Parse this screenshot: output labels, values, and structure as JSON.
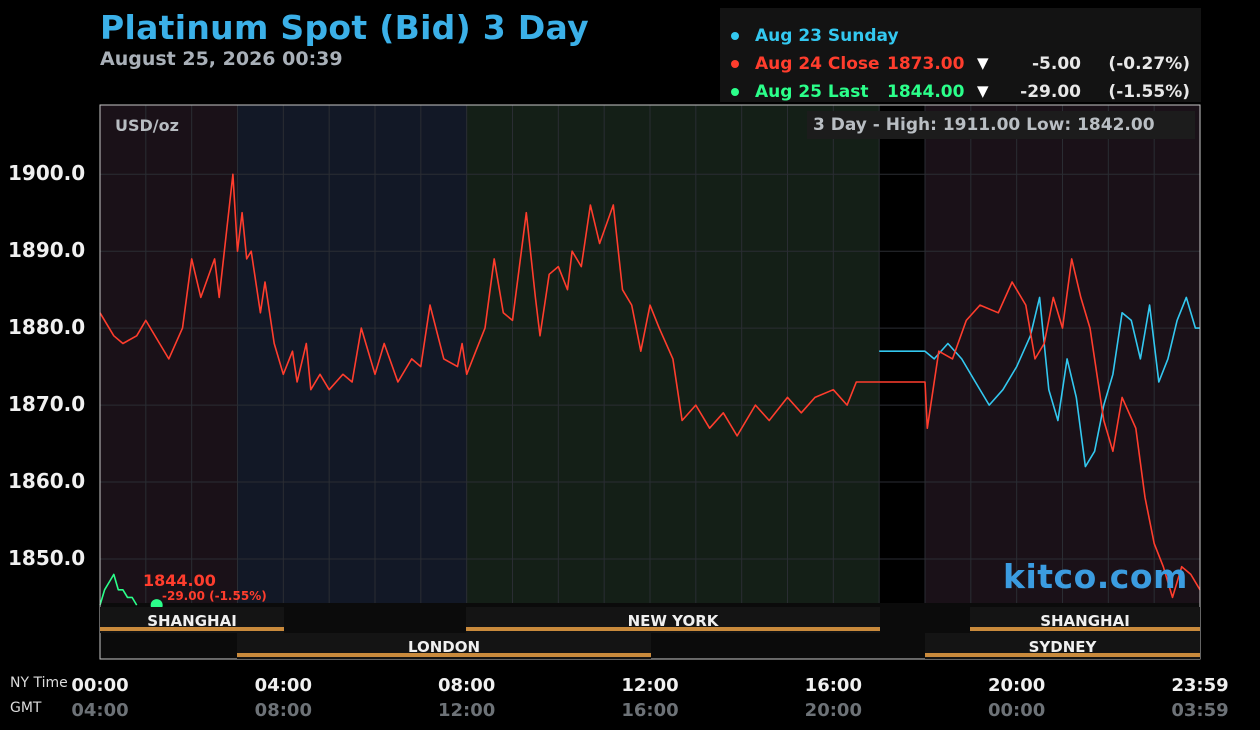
{
  "header": {
    "title": "Platinum Spot (Bid) 3 Day",
    "timestamp": "August 25, 2026 00:39"
  },
  "legend": [
    {
      "label": "Aug 23 Sunday",
      "price": "",
      "change": "",
      "percent": "",
      "arrow": "",
      "color": "#33c8f0"
    },
    {
      "label": "Aug 24 Close",
      "price": "1873.00",
      "change": "-5.00",
      "percent": "(-0.27%)",
      "arrow": "▼",
      "color": "#ff3d2d"
    },
    {
      "label": "Aug 25 Last",
      "price": "1844.00",
      "change": "-29.00",
      "percent": "(-1.55%)",
      "arrow": "▼",
      "color": "#2bff8a"
    }
  ],
  "unit_label": "USD/oz",
  "high_low": "3 Day - High: 1911.00  Low: 1842.00",
  "watermark": "kitco.com",
  "current": {
    "price": "1844.00",
    "change": "-29.00 (-1.55%)"
  },
  "row_labels": {
    "ny": "NY Time",
    "gmt": "GMT"
  },
  "markets": [
    "SHANGHAI",
    "LONDON",
    "NEW YORK",
    "SHANGHAI",
    "SYDNEY"
  ],
  "chart_data": {
    "type": "line",
    "title": "Platinum Spot (Bid) 3 Day",
    "ylabel": "USD/oz",
    "ylim": [
      1837,
      1909
    ],
    "xlim": [
      0,
      24
    ],
    "y_ticks": [
      "1900.0",
      "1890.0",
      "1880.0",
      "1870.0",
      "1860.0",
      "1850.0"
    ],
    "y_tick_values": [
      1900,
      1890,
      1880,
      1870,
      1860,
      1850
    ],
    "x_ticks_ny": [
      "00:00",
      "04:00",
      "08:00",
      "12:00",
      "16:00",
      "20:00",
      "23:59"
    ],
    "x_ticks_gmt": [
      "04:00",
      "08:00",
      "12:00",
      "16:00",
      "20:00",
      "00:00",
      "03:59"
    ],
    "x_tick_values": [
      0,
      4,
      8,
      12,
      16,
      20,
      24
    ],
    "colors": {
      "sunday": "#33c8f0",
      "close": "#ff3d2d",
      "last": "#2bff8a"
    },
    "series": [
      {
        "name": "Aug 24 Close",
        "x": [
          0,
          0.3,
          0.5,
          0.8,
          1.0,
          1.3,
          1.5,
          1.8,
          2.0,
          2.2,
          2.5,
          2.6,
          2.9,
          3.0,
          3.1,
          3.2,
          3.3,
          3.5,
          3.6,
          3.8,
          4.0,
          4.2,
          4.3,
          4.5,
          4.6,
          4.8,
          5.0,
          5.3,
          5.5,
          5.7,
          6.0,
          6.2,
          6.5,
          6.8,
          7.0,
          7.2,
          7.5,
          7.8,
          7.9,
          8.0,
          8.2,
          8.4,
          8.6,
          8.8,
          9.0,
          9.3,
          9.5,
          9.6,
          9.8,
          10.0,
          10.2,
          10.3,
          10.5,
          10.7,
          10.9,
          11.2,
          11.4,
          11.6,
          11.8,
          12.0,
          12.2,
          12.5,
          12.7,
          13.0,
          13.3,
          13.6,
          13.9,
          14.3,
          14.6,
          15.0,
          15.3,
          15.6,
          16.0,
          16.3,
          16.5,
          16.8,
          17.0,
          18.0,
          18.05,
          18.3,
          18.6,
          18.9,
          19.2,
          19.6,
          19.9,
          20.2,
          20.4,
          20.6,
          20.8,
          21.0,
          21.2,
          21.4,
          21.6,
          21.9,
          22.1,
          22.3,
          22.6,
          22.8,
          23.0,
          23.2,
          23.4,
          23.6,
          23.8,
          24.0
        ],
        "y": [
          1882,
          1879,
          1878,
          1879,
          1881,
          1878,
          1876,
          1880,
          1889,
          1884,
          1889,
          1884,
          1900,
          1890,
          1895,
          1889,
          1890,
          1882,
          1886,
          1878,
          1874,
          1877,
          1873,
          1878,
          1872,
          1874,
          1872,
          1874,
          1873,
          1880,
          1874,
          1878,
          1873,
          1876,
          1875,
          1883,
          1876,
          1875,
          1878,
          1874,
          1877,
          1880,
          1889,
          1882,
          1881,
          1895,
          1884,
          1879,
          1887,
          1888,
          1885,
          1890,
          1888,
          1896,
          1891,
          1896,
          1885,
          1883,
          1877,
          1883,
          1880,
          1876,
          1868,
          1870,
          1867,
          1869,
          1866,
          1870,
          1868,
          1871,
          1869,
          1871,
          1872,
          1870,
          1873,
          1873,
          1873,
          1873,
          1867,
          1877,
          1876,
          1881,
          1883,
          1882,
          1886,
          1883,
          1876,
          1878,
          1884,
          1880,
          1889,
          1884,
          1880,
          1868,
          1864,
          1871,
          1867,
          1858,
          1852,
          1849,
          1845,
          1849,
          1848,
          1846
        ]
      },
      {
        "name": "Aug 23 Sunday",
        "x": [
          17.0,
          18.0,
          18.2,
          18.5,
          18.8,
          19.1,
          19.4,
          19.7,
          20.0,
          20.3,
          20.5,
          20.7,
          20.9,
          21.1,
          21.3,
          21.5,
          21.7,
          21.9,
          22.1,
          22.3,
          22.5,
          22.7,
          22.9,
          23.1,
          23.3,
          23.5,
          23.7,
          23.9,
          24.0
        ],
        "y": [
          1877,
          1877,
          1876,
          1878,
          1876,
          1873,
          1870,
          1872,
          1875,
          1879,
          1884,
          1872,
          1868,
          1876,
          1871,
          1862,
          1864,
          1870,
          1874,
          1882,
          1881,
          1876,
          1883,
          1873,
          1876,
          1881,
          1884,
          1880,
          1880
        ]
      },
      {
        "name": "Aug 25 Last",
        "x": [
          0,
          0.1,
          0.2,
          0.3,
          0.4,
          0.5,
          0.6,
          0.7,
          0.8
        ],
        "y": [
          1844,
          1846,
          1847,
          1848,
          1846,
          1846,
          1845,
          1845,
          1844
        ]
      }
    ],
    "sessions": [
      {
        "name": "SHANGHAI",
        "start": 0,
        "end": 4
      },
      {
        "name": "LONDON",
        "start": 3,
        "end": 12
      },
      {
        "name": "NEW YORK",
        "start": 8,
        "end": 17
      },
      {
        "name": "SHANGHAI",
        "start": 19,
        "end": 24
      },
      {
        "name": "SYDNEY",
        "start": 18,
        "end": 24
      }
    ]
  }
}
